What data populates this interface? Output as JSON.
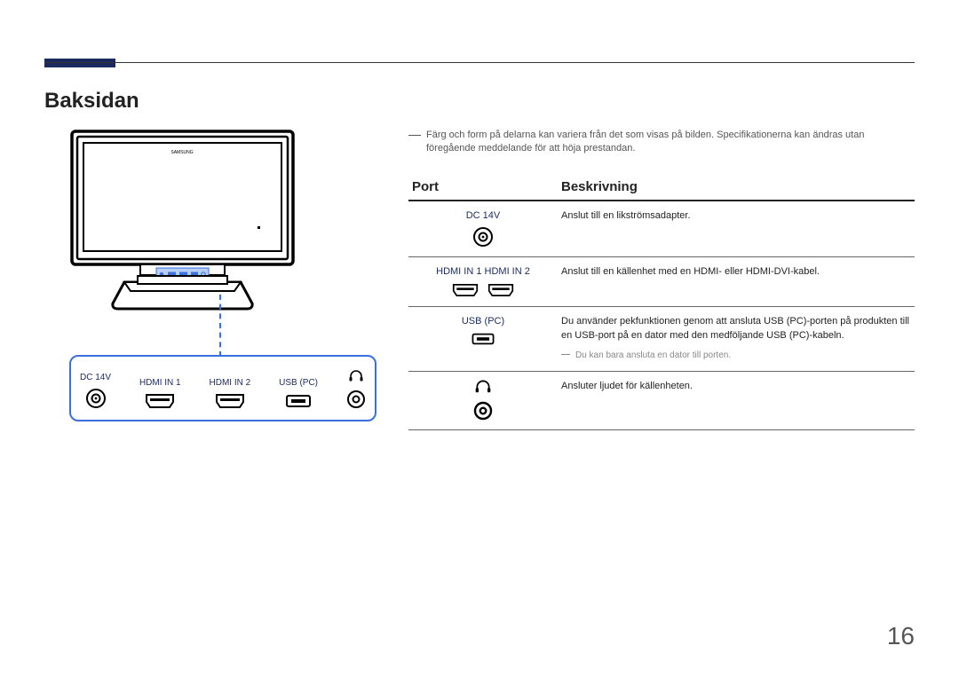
{
  "page": {
    "section_title": "Baksidan",
    "page_number": "16"
  },
  "note": "Färg och form på delarna kan variera från det som visas på bilden. Specifikationerna kan ändras utan föregående meddelande för att höja prestandan.",
  "panel_labels": {
    "dc14v": "DC 14V",
    "hdmi_in_1": "HDMI IN 1",
    "hdmi_in_2": "HDMI IN 2",
    "usb_pc": "USB (PC)"
  },
  "table": {
    "head_port": "Port",
    "head_desc": "Beskrivning",
    "rows": [
      {
        "label": "DC 14V",
        "desc": "Anslut till en likströmsadapter."
      },
      {
        "label": "HDMI IN 1   HDMI IN 2",
        "desc": "Anslut till en källenhet med en HDMI- eller HDMI-DVI-kabel."
      },
      {
        "label": "USB (PC)",
        "desc": "Du använder pekfunktionen genom att ansluta USB (PC)-porten på produkten till en USB-port på en dator med den medföljande USB (PC)-kabeln.",
        "subnote": "Du kan bara ansluta en dator till porten."
      },
      {
        "label": "",
        "desc": "Ansluter ljudet för källenheten."
      }
    ]
  },
  "monitor_brand": "SAMSUNG"
}
